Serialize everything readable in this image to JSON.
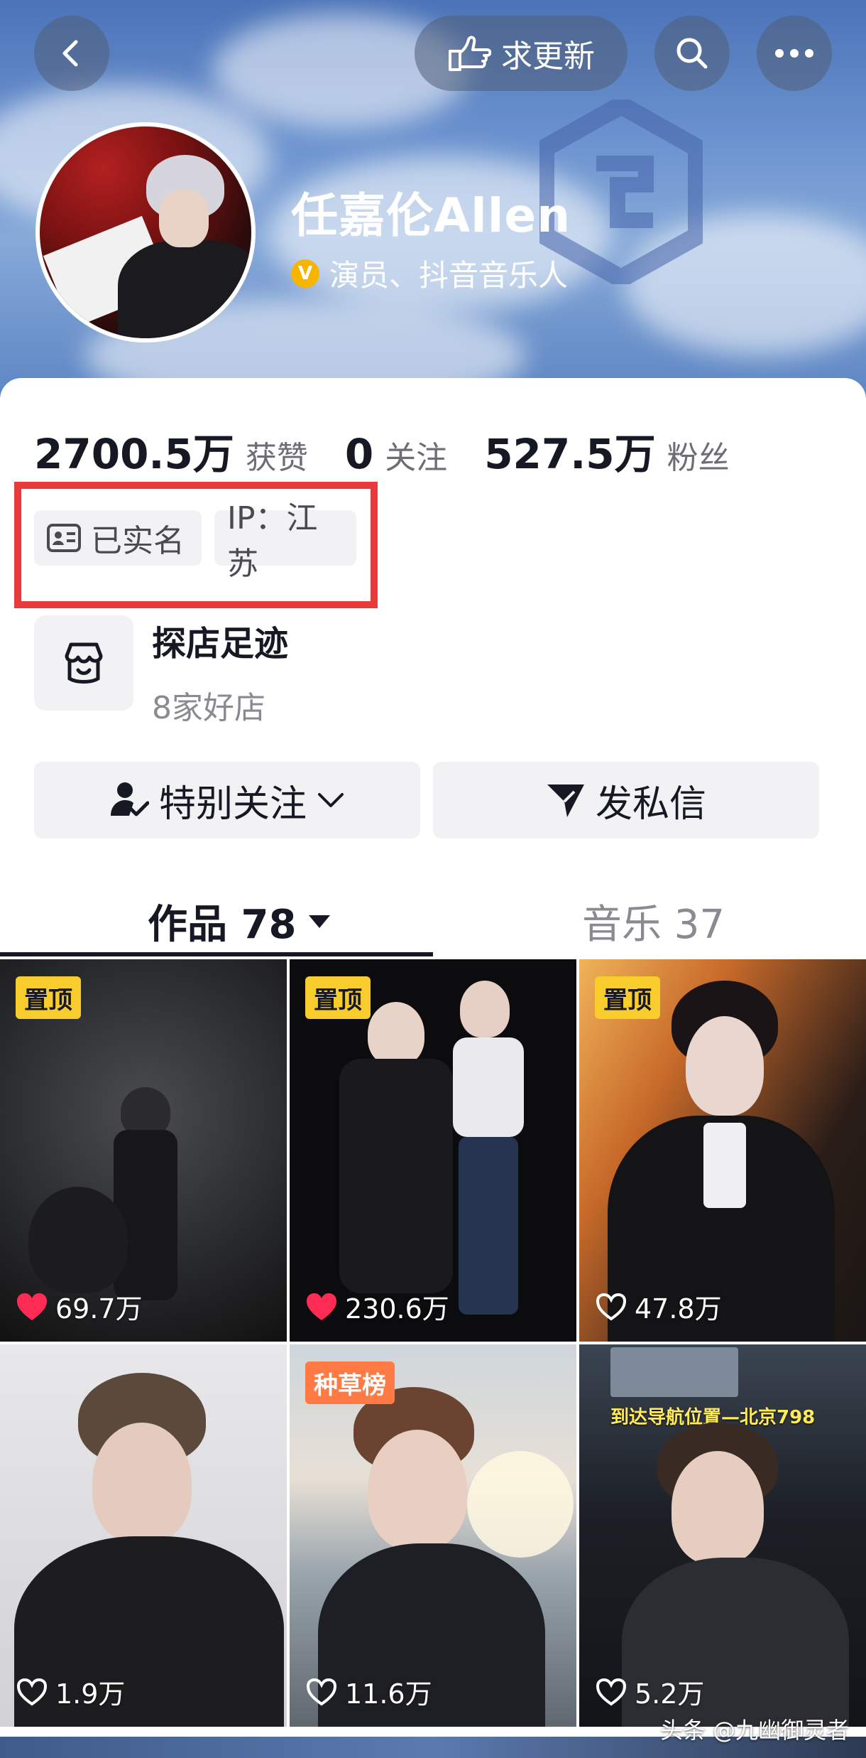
{
  "header": {
    "request_update_label": "求更新",
    "name": "任嘉伦Allen",
    "verify_badge": "V",
    "verify_text": "演员、抖音音乐人"
  },
  "stats": [
    {
      "value": "2700.5万",
      "label": "获赞"
    },
    {
      "value": "0",
      "label": "关注"
    },
    {
      "value": "527.5万",
      "label": "粉丝"
    }
  ],
  "tags": {
    "real_name": "已实名",
    "ip": "IP：江苏"
  },
  "shop": {
    "title": "探店足迹",
    "subtitle": "8家好店"
  },
  "actions": {
    "follow_label": "特别关注",
    "message_label": "发私信"
  },
  "tabs": {
    "works_label": "作品 78",
    "music_label": "音乐 37"
  },
  "videos": [
    {
      "badge": "置顶",
      "likes": "69.7万",
      "liked": true
    },
    {
      "badge": "置顶",
      "likes": "230.6万",
      "liked": true
    },
    {
      "badge": "置顶",
      "likes": "47.8万",
      "liked": false
    },
    {
      "badge": "",
      "likes": "1.9万",
      "liked": false
    },
    {
      "badge": "种草榜",
      "likes": "11.6万",
      "liked": false
    },
    {
      "badge": "",
      "likes": "5.2万",
      "liked": false,
      "caption": "到达导航位置—北京798"
    }
  ],
  "watermark": "头条 @九幽御灵者",
  "colors": {
    "pin_badge": "#f8cc2c",
    "hot_badge": "#ff7a45",
    "liked_heart": "#fe2c55",
    "highlight_box": "#e83a3a",
    "verify": "#f7b500"
  }
}
